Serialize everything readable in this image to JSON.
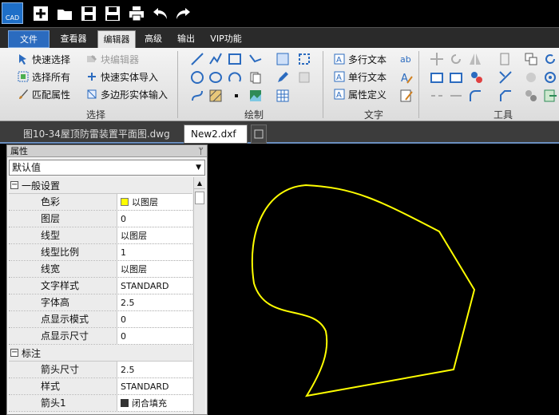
{
  "app": {
    "logo_text": "CAD"
  },
  "quick_access": [
    "new-icon",
    "open-folder-icon",
    "save-icon",
    "save-as-pdf-icon",
    "print-icon",
    "undo-icon",
    "redo-icon"
  ],
  "ribbon_tabs": [
    {
      "label": "文件",
      "kind": "file"
    },
    {
      "label": "查看器",
      "kind": "normal"
    },
    {
      "label": "编辑器",
      "kind": "active"
    },
    {
      "label": "高级",
      "kind": "normal"
    },
    {
      "label": "输出",
      "kind": "normal"
    },
    {
      "label": "VIP功能",
      "kind": "normal"
    }
  ],
  "ribbon": {
    "select_group": {
      "label": "选择",
      "quick_select": "快速选择",
      "select_all": "选择所有",
      "match_props": "匹配属性",
      "block_editor": "块编辑器",
      "quick_solid_import": "快速实体导入",
      "polygon_solid_input": "多边形实体输入"
    },
    "draw_group": {
      "label": "绘制"
    },
    "text_group": {
      "label": "文字",
      "mtext": "多行文本",
      "stext": "单行文本",
      "attdef": "属性定义"
    },
    "tools_group": {
      "label": "工具"
    }
  },
  "doc_tabs": [
    {
      "label": "图10-34屋顶防雷装置平面图.dwg",
      "active": false
    },
    {
      "label": "New2.dxf",
      "active": true
    }
  ],
  "panel": {
    "title": "属性",
    "pin": "ᛘ",
    "dropdown_value": "默认值",
    "general_category": "一般设置",
    "dim_category": "标注",
    "general_rows": [
      {
        "key": "色彩",
        "value": "以图层",
        "swatch": "#ffff00"
      },
      {
        "key": "图层",
        "value": "0"
      },
      {
        "key": "线型",
        "value": "以图层"
      },
      {
        "key": "线型比例",
        "value": "1"
      },
      {
        "key": "线宽",
        "value": "以图层"
      },
      {
        "key": "文字样式",
        "value": "STANDARD"
      },
      {
        "key": "字体高",
        "value": "2.5"
      },
      {
        "key": "点显示模式",
        "value": "0"
      },
      {
        "key": "点显示尺寸",
        "value": "0"
      }
    ],
    "dim_rows": [
      {
        "key": "箭头尺寸",
        "value": "2.5"
      },
      {
        "key": "样式",
        "value": "STANDARD"
      },
      {
        "key": "箭头1",
        "value": "闭合填充"
      }
    ]
  },
  "canvas": {
    "background": "#000000",
    "shape_color": "#ffff00"
  }
}
